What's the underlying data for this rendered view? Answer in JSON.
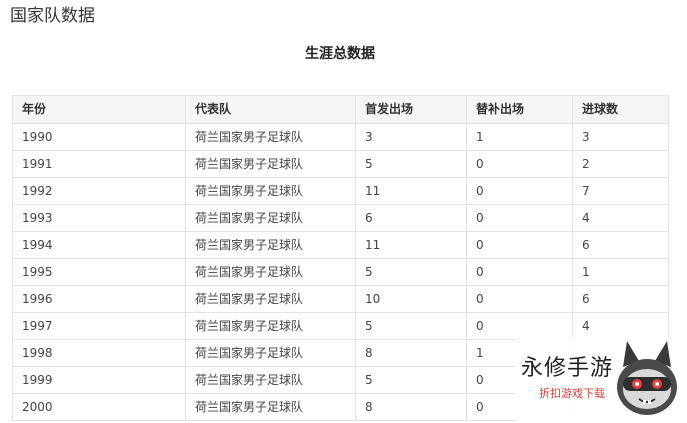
{
  "page": {
    "section_title": "国家队数据",
    "table_caption": "生涯总数据"
  },
  "table": {
    "headers": [
      "年份",
      "代表队",
      "首发出场",
      "替补出场",
      "进球数"
    ],
    "rows": [
      [
        "1990",
        "荷兰国家男子足球队",
        "3",
        "1",
        "3"
      ],
      [
        "1991",
        "荷兰国家男子足球队",
        "5",
        "0",
        "2"
      ],
      [
        "1992",
        "荷兰国家男子足球队",
        "11",
        "0",
        "7"
      ],
      [
        "1993",
        "荷兰国家男子足球队",
        "6",
        "0",
        "4"
      ],
      [
        "1994",
        "荷兰国家男子足球队",
        "11",
        "0",
        "6"
      ],
      [
        "1995",
        "荷兰国家男子足球队",
        "5",
        "0",
        "1"
      ],
      [
        "1996",
        "荷兰国家男子足球队",
        "10",
        "0",
        "6"
      ],
      [
        "1997",
        "荷兰国家男子足球队",
        "5",
        "0",
        "4"
      ],
      [
        "1998",
        "荷兰国家男子足球队",
        "8",
        "1",
        ""
      ],
      [
        "1999",
        "荷兰国家男子足球队",
        "5",
        "0",
        ""
      ],
      [
        "2000",
        "荷兰国家男子足球队",
        "8",
        "0",
        ""
      ]
    ]
  },
  "watermark": {
    "brand": "永修手游",
    "tagline": "折扣游戏下载",
    "logo_icon": "robot-head-icon",
    "brand_color": "#e0413a"
  }
}
